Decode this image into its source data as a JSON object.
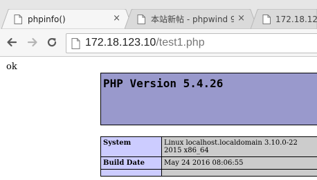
{
  "tabs": [
    {
      "title": "phpinfo()",
      "close": "×",
      "active": true
    },
    {
      "title": "本站新帖 - phpwind 9",
      "close": "×",
      "active": false
    },
    {
      "title": "172.18.123",
      "close": "",
      "active": false
    }
  ],
  "toolbar": {
    "url_host": "172.18.123.10",
    "url_path": "/test1.php"
  },
  "page": {
    "ok_text": "ok",
    "php_version": "PHP Version 5.4.26",
    "rows": [
      {
        "key": "System",
        "value_line1": "Linux localhost.localdomain 3.10.0-22",
        "value_line2": "2015 x86_64"
      },
      {
        "key": "Build Date",
        "value_line1": "May 24 2016 08:06:55",
        "value_line2": ""
      }
    ]
  },
  "colors": {
    "php_header": "#9999cc",
    "php_key_bg": "#ccccff",
    "php_val_bg": "#cccccc"
  }
}
